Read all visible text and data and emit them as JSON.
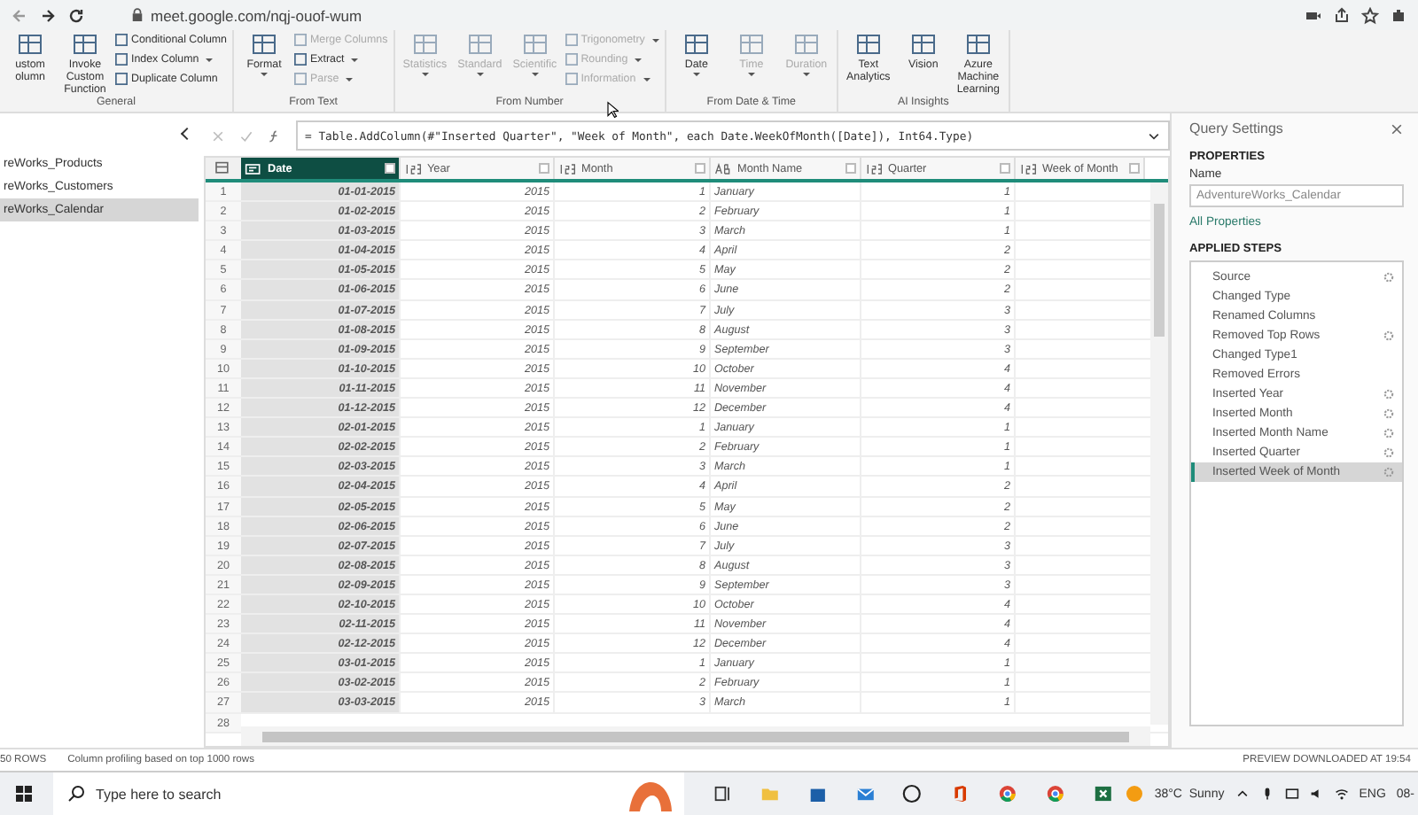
{
  "browser": {
    "url": "meet.google.com/nqj-ouof-wum"
  },
  "ribbon": {
    "groups": [
      {
        "label": "General",
        "large": [
          {
            "label": "ustom olumn",
            "disabled": false,
            "dropdown": false
          },
          {
            "label": "Invoke Custom Function",
            "disabled": false,
            "dropdown": false
          }
        ],
        "small": [
          {
            "label": "Conditional Column",
            "disabled": false,
            "dropdown": false
          },
          {
            "label": "Index Column",
            "disabled": false,
            "dropdown": true
          },
          {
            "label": "Duplicate Column",
            "disabled": false,
            "dropdown": false
          }
        ]
      },
      {
        "label": "From Text",
        "large": [
          {
            "label": "Format",
            "disabled": false,
            "dropdown": true
          }
        ],
        "small": [
          {
            "label": "Merge Columns",
            "disabled": true,
            "dropdown": false
          },
          {
            "label": "Extract",
            "disabled": false,
            "dropdown": true
          },
          {
            "label": "Parse",
            "disabled": true,
            "dropdown": true
          }
        ]
      },
      {
        "label": "From Number",
        "large": [
          {
            "label": "Statistics",
            "disabled": true,
            "dropdown": true
          },
          {
            "label": "Standard",
            "disabled": true,
            "dropdown": true
          },
          {
            "label": "Scientific",
            "disabled": true,
            "dropdown": true
          }
        ],
        "small": [
          {
            "label": "Trigonometry",
            "disabled": true,
            "dropdown": true
          },
          {
            "label": "Rounding",
            "disabled": true,
            "dropdown": true
          },
          {
            "label": "Information",
            "disabled": true,
            "dropdown": true
          }
        ]
      },
      {
        "label": "From Date & Time",
        "large": [
          {
            "label": "Date",
            "disabled": false,
            "dropdown": true
          },
          {
            "label": "Time",
            "disabled": true,
            "dropdown": true
          },
          {
            "label": "Duration",
            "disabled": true,
            "dropdown": true
          }
        ]
      },
      {
        "label": "AI Insights",
        "large": [
          {
            "label": "Text Analytics",
            "disabled": false,
            "dropdown": false
          },
          {
            "label": "Vision",
            "disabled": false,
            "dropdown": false
          },
          {
            "label": "Azure Machine Learning",
            "disabled": false,
            "dropdown": false
          }
        ]
      }
    ]
  },
  "queries": [
    {
      "name": "reWorks_Products",
      "selected": false
    },
    {
      "name": "reWorks_Customers",
      "selected": false
    },
    {
      "name": "reWorks_Calendar",
      "selected": true
    }
  ],
  "formula": "= Table.AddColumn(#\"Inserted Quarter\", \"Week of Month\", each Date.WeekOfMonth([Date]), Int64.Type)",
  "table": {
    "columns": [
      {
        "name": "Date",
        "kind": "date",
        "selected": true
      },
      {
        "name": "Year",
        "kind": "number",
        "selected": false
      },
      {
        "name": "Month",
        "kind": "number",
        "selected": false
      },
      {
        "name": "Month Name",
        "kind": "text",
        "selected": false
      },
      {
        "name": "Quarter",
        "kind": "number",
        "selected": false
      },
      {
        "name": "Week of Month",
        "kind": "number",
        "selected": false
      }
    ],
    "rows": [
      [
        "1",
        "01-01-2015",
        "2015",
        "1",
        "January",
        "1"
      ],
      [
        "2",
        "01-02-2015",
        "2015",
        "2",
        "February",
        "1"
      ],
      [
        "3",
        "01-03-2015",
        "2015",
        "3",
        "March",
        "1"
      ],
      [
        "4",
        "01-04-2015",
        "2015",
        "4",
        "April",
        "2"
      ],
      [
        "5",
        "01-05-2015",
        "2015",
        "5",
        "May",
        "2"
      ],
      [
        "6",
        "01-06-2015",
        "2015",
        "6",
        "June",
        "2"
      ],
      [
        "7",
        "01-07-2015",
        "2015",
        "7",
        "July",
        "3"
      ],
      [
        "8",
        "01-08-2015",
        "2015",
        "8",
        "August",
        "3"
      ],
      [
        "9",
        "01-09-2015",
        "2015",
        "9",
        "September",
        "3"
      ],
      [
        "10",
        "01-10-2015",
        "2015",
        "10",
        "October",
        "4"
      ],
      [
        "11",
        "01-11-2015",
        "2015",
        "11",
        "November",
        "4"
      ],
      [
        "12",
        "01-12-2015",
        "2015",
        "12",
        "December",
        "4"
      ],
      [
        "13",
        "02-01-2015",
        "2015",
        "1",
        "January",
        "1"
      ],
      [
        "14",
        "02-02-2015",
        "2015",
        "2",
        "February",
        "1"
      ],
      [
        "15",
        "02-03-2015",
        "2015",
        "3",
        "March",
        "1"
      ],
      [
        "16",
        "02-04-2015",
        "2015",
        "4",
        "April",
        "2"
      ],
      [
        "17",
        "02-05-2015",
        "2015",
        "5",
        "May",
        "2"
      ],
      [
        "18",
        "02-06-2015",
        "2015",
        "6",
        "June",
        "2"
      ],
      [
        "19",
        "02-07-2015",
        "2015",
        "7",
        "July",
        "3"
      ],
      [
        "20",
        "02-08-2015",
        "2015",
        "8",
        "August",
        "3"
      ],
      [
        "21",
        "02-09-2015",
        "2015",
        "9",
        "September",
        "3"
      ],
      [
        "22",
        "02-10-2015",
        "2015",
        "10",
        "October",
        "4"
      ],
      [
        "23",
        "02-11-2015",
        "2015",
        "11",
        "November",
        "4"
      ],
      [
        "24",
        "02-12-2015",
        "2015",
        "12",
        "December",
        "4"
      ],
      [
        "25",
        "03-01-2015",
        "2015",
        "1",
        "January",
        "1"
      ],
      [
        "26",
        "03-02-2015",
        "2015",
        "2",
        "February",
        "1"
      ],
      [
        "27",
        "03-03-2015",
        "2015",
        "3",
        "March",
        "1"
      ],
      [
        "28"
      ]
    ]
  },
  "query_settings": {
    "title": "Query Settings",
    "properties_heading": "PROPERTIES",
    "name_label": "Name",
    "name_value": "AdventureWorks_Calendar",
    "all_properties": "All Properties",
    "steps_heading": "APPLIED STEPS",
    "steps": [
      {
        "label": "Source",
        "has_settings": true,
        "selected": false
      },
      {
        "label": "Changed Type",
        "has_settings": false,
        "selected": false
      },
      {
        "label": "Renamed Columns",
        "has_settings": false,
        "selected": false
      },
      {
        "label": "Removed Top Rows",
        "has_settings": true,
        "selected": false
      },
      {
        "label": "Changed Type1",
        "has_settings": false,
        "selected": false
      },
      {
        "label": "Removed Errors",
        "has_settings": false,
        "selected": false
      },
      {
        "label": "Inserted Year",
        "has_settings": true,
        "selected": false
      },
      {
        "label": "Inserted Month",
        "has_settings": true,
        "selected": false
      },
      {
        "label": "Inserted Month Name",
        "has_settings": true,
        "selected": false
      },
      {
        "label": "Inserted Quarter",
        "has_settings": true,
        "selected": false
      },
      {
        "label": "Inserted Week of Month",
        "has_settings": true,
        "selected": true
      }
    ]
  },
  "status_bar": {
    "rows": "50 ROWS",
    "profiling": "Column profiling based on top 1000 rows",
    "preview": "PREVIEW DOWNLOADED AT 19:54"
  },
  "taskbar": {
    "search_placeholder": "Type here to search",
    "weather": "38°C  Sunny",
    "language": "ENG",
    "clock": "08-"
  }
}
